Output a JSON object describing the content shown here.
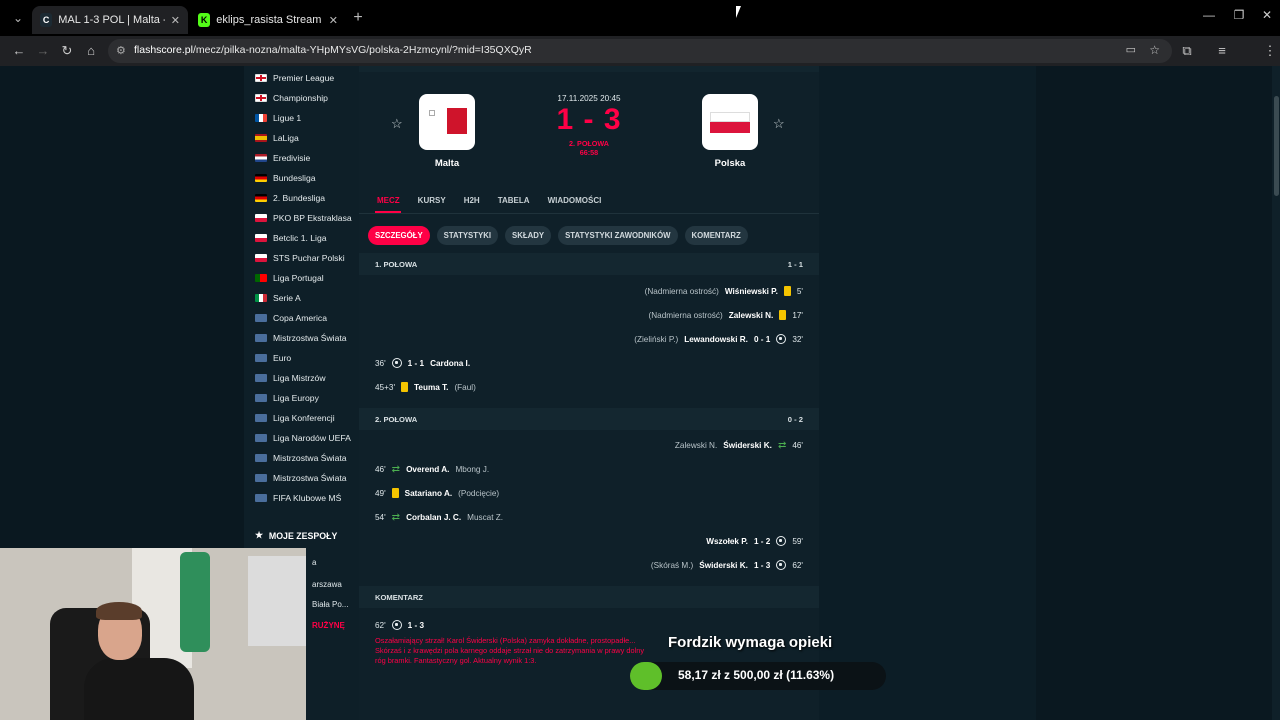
{
  "browser": {
    "tabs": [
      {
        "title": "MAL 1-3 POL | Malta - Polska 1",
        "active": true
      },
      {
        "title": "eklips_rasista Stream - Watch L",
        "active": false
      }
    ],
    "url_host": "flashscore.pl",
    "url_path": "/mecz/pilka-nozna/malta-YHpMYsVG/polska-2Hzmcynl/?mid=I35QXQyR",
    "profile_initial": "F"
  },
  "sidebar": {
    "leagues": [
      {
        "name": "Premier League",
        "flag": "eng"
      },
      {
        "name": "Championship",
        "flag": "eng"
      },
      {
        "name": "Ligue 1",
        "flag": "fra"
      },
      {
        "name": "LaLiga",
        "flag": "esp"
      },
      {
        "name": "Eredivisie",
        "flag": "ned"
      },
      {
        "name": "Bundesliga",
        "flag": "ger"
      },
      {
        "name": "2. Bundesliga",
        "flag": "ger"
      },
      {
        "name": "PKO BP Ekstraklasa",
        "flag": "pol"
      },
      {
        "name": "Betclic 1. Liga",
        "flag": "pol"
      },
      {
        "name": "STS Puchar Polski",
        "flag": "pol"
      },
      {
        "name": "Liga Portugal",
        "flag": "por"
      },
      {
        "name": "Serie A",
        "flag": "ita"
      },
      {
        "name": "Copa America",
        "flag": "world"
      },
      {
        "name": "Mistrzostwa Świata",
        "flag": "world"
      },
      {
        "name": "Euro",
        "flag": "world"
      },
      {
        "name": "Liga Mistrzów",
        "flag": "world"
      },
      {
        "name": "Liga Europy",
        "flag": "world"
      },
      {
        "name": "Liga Konferencji",
        "flag": "world"
      },
      {
        "name": "Liga Narodów UEFA",
        "flag": "world"
      },
      {
        "name": "Mistrzostwa Świata",
        "flag": "world"
      },
      {
        "name": "Mistrzostwa Świata",
        "flag": "world"
      },
      {
        "name": "FIFA Klubowe MŚ",
        "flag": "world"
      }
    ],
    "my_teams_label": "MOJE ZESPOŁY",
    "my_teams_partial": [
      "a",
      "arszawa",
      "Biała Po...",
      "RUŻYNĘ"
    ]
  },
  "match": {
    "home": "Malta",
    "away": "Polska",
    "datetime": "17.11.2025 20:45",
    "score": "1 - 3",
    "status": "2. POŁOWA",
    "clock": "66:58"
  },
  "main_tabs": [
    "MECZ",
    "KURSY",
    "H2H",
    "TABELA",
    "WIADOMOŚCI"
  ],
  "sub_tabs": [
    "SZCZEGÓŁY",
    "STATYSTYKI",
    "SKŁADY",
    "STATYSTYKI ZAWODNIKÓW",
    "KOMENTARZ"
  ],
  "half1": {
    "label": "1. POŁOWA",
    "score": "1 - 1",
    "events": [
      {
        "side": "right",
        "minute": "5'",
        "type": "yellow",
        "player": "Wiśniewski P.",
        "detail": "(Nadmierna ostrość)"
      },
      {
        "side": "right",
        "minute": "17'",
        "type": "yellow",
        "player": "Zalewski N.",
        "detail": "(Nadmierna ostrość)"
      },
      {
        "side": "right",
        "minute": "32'",
        "type": "goal",
        "player": "Lewandowski R.",
        "detail": "(Zieliński P.)",
        "score": "0 - 1"
      },
      {
        "side": "left",
        "minute": "36'",
        "type": "goal",
        "player": "Cardona I.",
        "detail": "",
        "score": "1 - 1"
      },
      {
        "side": "left",
        "minute": "45+3'",
        "type": "yellow",
        "player": "Teuma T.",
        "detail": "(Faul)"
      }
    ]
  },
  "half2": {
    "label": "2. POŁOWA",
    "score": "0 - 2",
    "events": [
      {
        "side": "right",
        "minute": "46'",
        "type": "sub",
        "player": "Świderski K.",
        "detail": "Zalewski N."
      },
      {
        "side": "left",
        "minute": "46'",
        "type": "sub",
        "player": "Overend A.",
        "detail": "Mbong J."
      },
      {
        "side": "left",
        "minute": "49'",
        "type": "yellow",
        "player": "Satariano A.",
        "detail": "(Podcięcie)"
      },
      {
        "side": "left",
        "minute": "54'",
        "type": "sub",
        "player": "Corbalan J. C.",
        "detail": "Muscat Z."
      },
      {
        "side": "right",
        "minute": "59'",
        "type": "goal",
        "player": "Wszołek P.",
        "detail": "",
        "score": "1 - 2"
      },
      {
        "side": "right",
        "minute": "62'",
        "type": "goal",
        "player": "Świderski K.",
        "detail": "(Skóraś M.)",
        "score": "1 - 3"
      }
    ]
  },
  "commentary": {
    "label": "KOMENTARZ",
    "minute": "62'",
    "score": "1 - 3",
    "text": "Oszałamiający strzał! Karol Świderski (Polska) zamyka dokładne, prostopadłe... Skórzaś i z krawędzi pola karnego oddaje strzał nie do zatrzymania w prawy dolny róg bramki. Fantastyczny gol. Aktualny wynik 1:3."
  },
  "donation": {
    "title": "Fordzik wymaga opieki",
    "amount_text": "58,17 zł z 500,00 zł (11.63%)",
    "progress": 0.1163
  }
}
